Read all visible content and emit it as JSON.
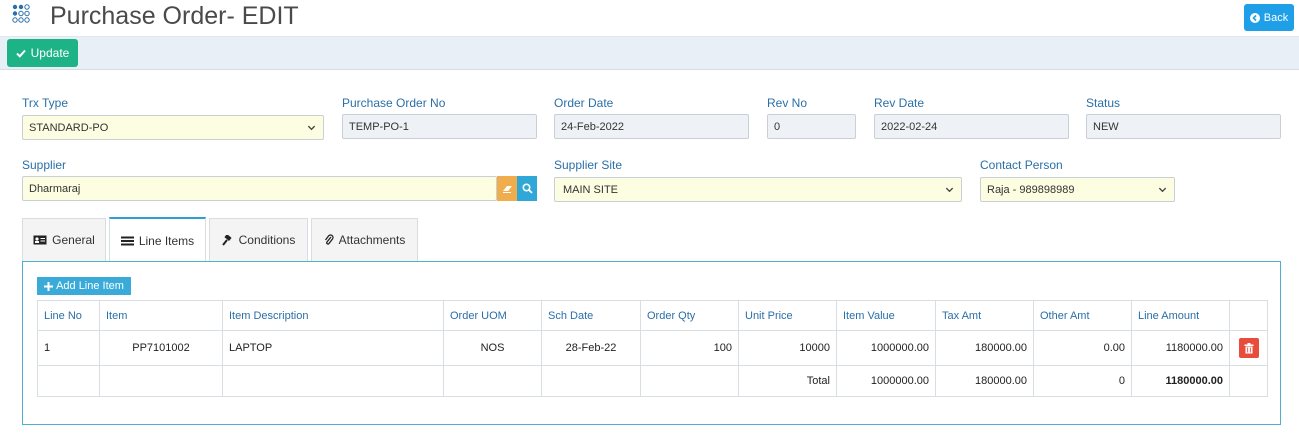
{
  "header": {
    "title": "Purchase Order- EDIT",
    "back_label": "Back"
  },
  "toolbar": {
    "update_label": "Update"
  },
  "form": {
    "trx_type": {
      "label": "Trx Type",
      "value": "STANDARD-PO"
    },
    "po_no": {
      "label": "Purchase Order No",
      "value": "TEMP-PO-1"
    },
    "order_date": {
      "label": "Order Date",
      "value": "24-Feb-2022"
    },
    "rev_no": {
      "label": "Rev No",
      "value": "0"
    },
    "rev_date": {
      "label": "Rev Date",
      "value": "2022-02-24"
    },
    "status": {
      "label": "Status",
      "value": "NEW"
    },
    "supplier": {
      "label": "Supplier",
      "value": "Dharmaraj"
    },
    "supplier_site": {
      "label": "Supplier Site",
      "value": "MAIN SITE"
    },
    "contact_person": {
      "label": "Contact Person",
      "value": "Raja - 989898989"
    }
  },
  "tabs": [
    {
      "label": "General"
    },
    {
      "label": "Line Items"
    },
    {
      "label": "Conditions"
    },
    {
      "label": "Attachments"
    }
  ],
  "line_items": {
    "add_label": "Add Line Item",
    "columns": [
      "Line No",
      "Item",
      "Item Description",
      "Order UOM",
      "Sch Date",
      "Order Qty",
      "Unit Price",
      "Item Value",
      "Tax Amt",
      "Other Amt",
      "Line Amount"
    ],
    "rows": [
      {
        "line_no": "1",
        "item": "PP7101002",
        "description": "LAPTOP",
        "uom": "NOS",
        "sch_date": "28-Feb-22",
        "qty": "100",
        "unit_price": "10000",
        "item_value": "1000000.00",
        "tax_amt": "180000.00",
        "other_amt": "0.00",
        "line_amount": "1180000.00"
      }
    ],
    "total": {
      "label": "Total",
      "item_value": "1000000.00",
      "tax_amt": "180000.00",
      "other_amt": "0",
      "line_amount": "1180000.00"
    }
  },
  "colors": {
    "primary": "#1e9fe8",
    "success": "#1eb386",
    "danger": "#e74c3c",
    "label": "#2a6fa8",
    "tab_accent": "#2f9ed0"
  }
}
